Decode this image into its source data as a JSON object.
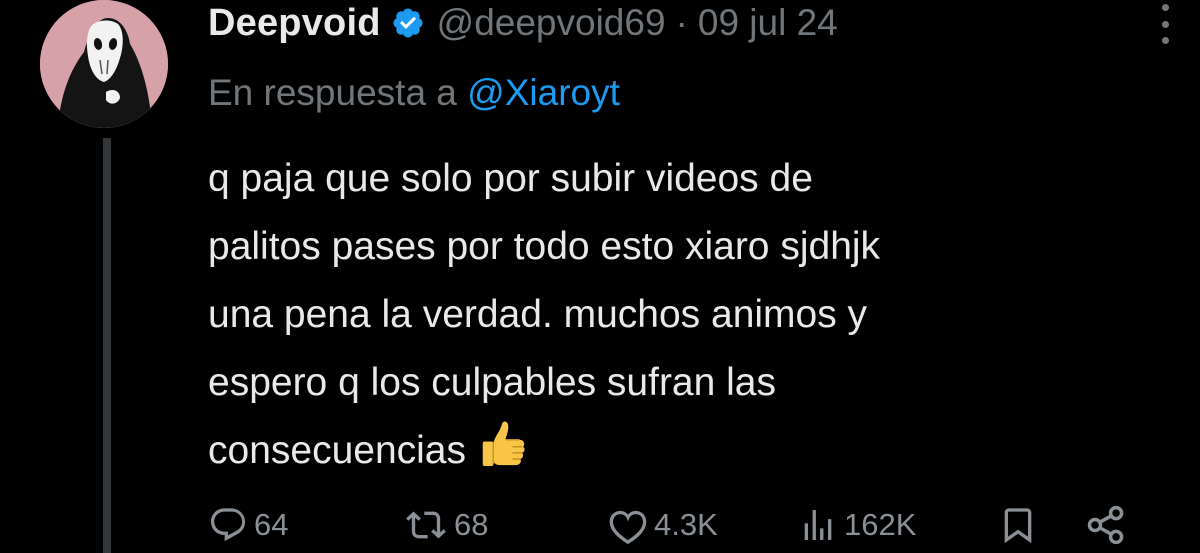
{
  "tweet": {
    "display_name": "Deepvoid",
    "handle": "@deepvoid69",
    "separator": "·",
    "date": "09 jul 24",
    "reply_prefix": "En respuesta a",
    "reply_to": "@Xiaroyt",
    "body_lines": [
      "q paja que solo por subir videos de",
      "palitos pases por todo esto xiaro sjdhjk",
      "una pena la verdad. muchos animos y",
      "espero q los culpables sufran las",
      "consecuencias"
    ],
    "emoji": "thumbs-up"
  },
  "actions": {
    "replies": "64",
    "reposts": "68",
    "likes": "4.3K",
    "views": "162K"
  },
  "icons": {
    "verified": "verified-badge-icon",
    "more": "more-options-icon",
    "reply": "reply-icon",
    "repost": "repost-icon",
    "like": "heart-icon",
    "views": "views-icon",
    "bookmark": "bookmark-icon",
    "share": "share-icon"
  },
  "colors": {
    "background": "#000000",
    "text": "#e7e9ea",
    "muted": "#71767b",
    "accent": "#1d9bf0",
    "avatar_bg": "#d7a2a7"
  }
}
